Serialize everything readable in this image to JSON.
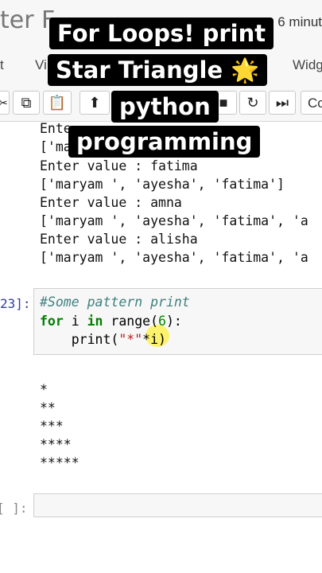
{
  "header": {
    "logo_partial": "ter",
    "logo_second": "F",
    "save_status": "6 minut"
  },
  "menu": {
    "items": [
      "t",
      "Vi",
      "Widg"
    ]
  },
  "toolbar": {
    "cell_type": "Co"
  },
  "title_overlay": {
    "line1": "For Loops! print",
    "line2": "Star Triangle",
    "line2_emoji": "🌟",
    "line3": "python",
    "line4": "programming"
  },
  "previous_output": [
    "Ente",
    "['ma",
    "Enter value : fatima",
    "['maryam ', 'ayesha', 'fatima']",
    "Enter value : amna",
    "['maryam ', 'ayesha', 'fatima', 'a",
    "Enter value : alisha",
    "['maryam ', 'ayesha', 'fatima', 'a"
  ],
  "cell": {
    "prompt": "23]:",
    "comment": "#Some pattern print",
    "line2_for": "for",
    "line2_i": " i ",
    "line2_in": "in",
    "line2_range": " range(",
    "line2_num": "6",
    "line2_end": "):",
    "line3_print": "    print(",
    "line3_str": "\"*\"",
    "line3_end": "*i)"
  },
  "output": [
    "*",
    "**",
    "***",
    "****",
    "*****"
  ],
  "empty_cell": {
    "prompt": "[ ]:"
  }
}
